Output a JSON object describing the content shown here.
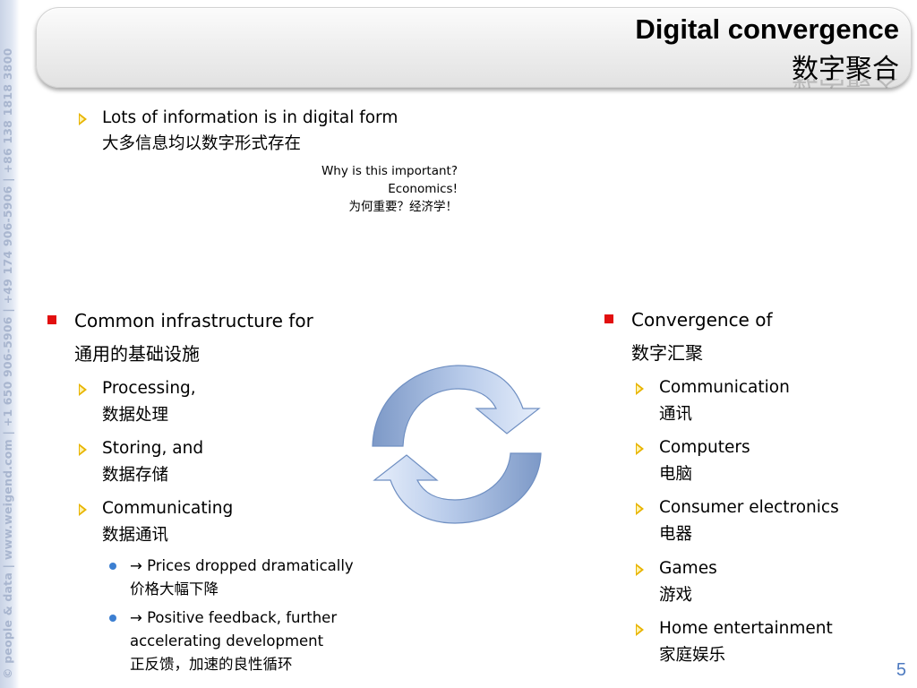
{
  "sidebar": {
    "copyright": "© people & data | www.weigend.com | +1 650 906-5906 | +49 174 906-5906 | +86 138 1818 3800"
  },
  "title": {
    "en": "Digital convergence",
    "zh": "数字聚合"
  },
  "top_bullet": {
    "en": "Lots of information is in digital form",
    "zh": "大多信息均以数字形式存在"
  },
  "note": {
    "line1": "Why is this important?",
    "line2": "Economics!",
    "line3": "为何重要？经济学！"
  },
  "left": {
    "heading_en": "Common infrastructure for",
    "heading_zh": "通用的基础设施",
    "items": [
      {
        "en": "Processing,",
        "zh": "数据处理"
      },
      {
        "en": "Storing, and",
        "zh": "数据存储"
      },
      {
        "en": "Communicating",
        "zh": "数据通讯"
      }
    ],
    "sub_items": [
      {
        "lines": [
          "→ Prices dropped dramatically",
          "价格大幅下降"
        ]
      },
      {
        "lines": [
          "→ Positive feedback, further",
          "accelerating development",
          "正反馈，加速的良性循环"
        ]
      }
    ]
  },
  "right": {
    "heading_en": "Convergence of",
    "heading_zh": "数字汇聚",
    "items": [
      {
        "en": "Communication",
        "zh": "通讯"
      },
      {
        "en": "Computers",
        "zh": "电脑"
      },
      {
        "en": "Consumer electronics",
        "zh": "电器"
      },
      {
        "en": "Games",
        "zh": "游戏"
      },
      {
        "en": "Home entertainment",
        "zh": "家庭娱乐"
      }
    ]
  },
  "page_number": "5",
  "colors": {
    "bullet_square": "#e20f0f",
    "bullet_triangle": "#e8b400",
    "bullet_dot": "#3c7fd1",
    "arrow_blue": "#7f9fd0",
    "page_number": "#4d7ac0"
  },
  "icons": [
    "triangle-bullet-icon",
    "square-bullet-icon",
    "dot-bullet-icon",
    "cycle-arrows-icon"
  ]
}
